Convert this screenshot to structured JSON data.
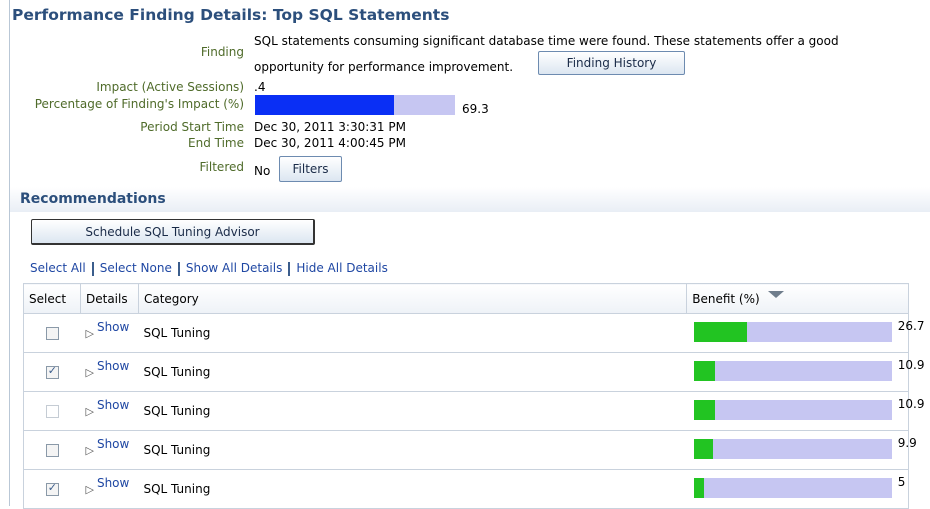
{
  "page": {
    "title": "Performance Finding Details: Top SQL Statements"
  },
  "finding": {
    "finding_label": "Finding",
    "finding_text_line1": "SQL statements consuming significant database time were found. These statements offer a good",
    "finding_text_line2": "opportunity for performance improvement.",
    "finding_history_button": "Finding History",
    "impact_label": "Impact (Active Sessions)",
    "impact_value": ".4",
    "pct_label": "Percentage of Finding's Impact (%)",
    "pct_value": "69.3",
    "pct_fraction": 0.693,
    "start_label": "Period Start Time",
    "start_value": "Dec 30, 2011 3:30:31 PM",
    "end_label": "End Time",
    "end_value": "Dec 30, 2011 4:00:45 PM",
    "filtered_label": "Filtered",
    "filtered_value": "No",
    "filters_button": "Filters"
  },
  "recommendations": {
    "title": "Recommendations",
    "schedule_button": "Schedule SQL Tuning Advisor",
    "links": {
      "select_all": "Select All",
      "select_none": "Select None",
      "show_all": "Show All Details",
      "hide_all": "Hide All Details"
    },
    "columns": {
      "select": "Select",
      "details": "Details",
      "category": "Category",
      "benefit": "Benefit (%)"
    },
    "rows": [
      {
        "checked": false,
        "disabled": false,
        "details": "Show",
        "category": "SQL Tuning",
        "benefit": "26.7",
        "benefit_fraction": 0.267
      },
      {
        "checked": true,
        "disabled": false,
        "details": "Show",
        "category": "SQL Tuning",
        "benefit": "10.9",
        "benefit_fraction": 0.109
      },
      {
        "checked": false,
        "disabled": true,
        "details": "Show",
        "category": "SQL Tuning",
        "benefit": "10.9",
        "benefit_fraction": 0.109
      },
      {
        "checked": false,
        "disabled": false,
        "details": "Show",
        "category": "SQL Tuning",
        "benefit": "9.9",
        "benefit_fraction": 0.099
      },
      {
        "checked": true,
        "disabled": false,
        "details": "Show",
        "category": "SQL Tuning",
        "benefit": "5",
        "benefit_fraction": 0.05
      }
    ]
  },
  "colors": {
    "impact_bar": "#0a2ff5",
    "benefit_bar": "#22c422",
    "track": "#c6c6f2"
  }
}
